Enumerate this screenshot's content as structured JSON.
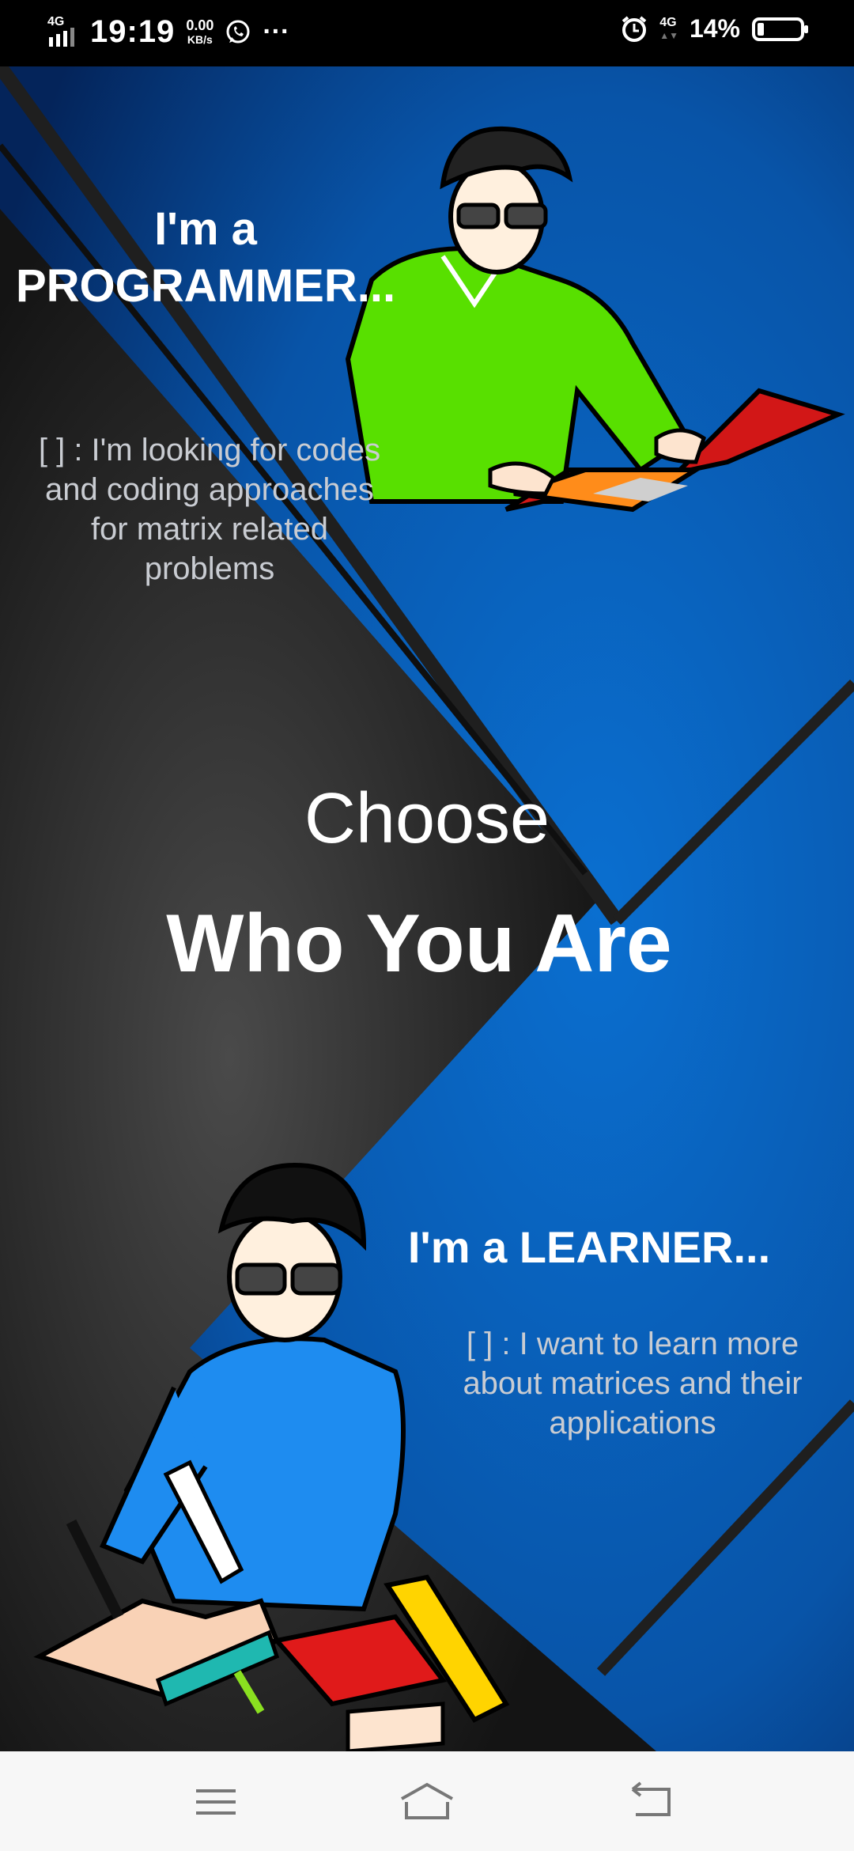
{
  "status_bar": {
    "network": "4G",
    "time": "19:19",
    "speed_value": "0.00",
    "speed_unit": "KB/s",
    "more": "···",
    "network_right": "4G",
    "battery": "14%"
  },
  "programmer": {
    "title_line1": "I'm a",
    "title_line2": "PROGRAMMER...",
    "description": "[ ] : I'm looking for codes and coding approaches for matrix related problems"
  },
  "heading": {
    "choose": "Choose",
    "who": "Who You Are"
  },
  "learner": {
    "title": "I'm a LEARNER...",
    "description": "[ ] : I want to learn more about matrices and their applications"
  },
  "nav": {
    "menu_icon": "menu-icon",
    "home_icon": "home-icon",
    "back_icon": "back-icon"
  }
}
